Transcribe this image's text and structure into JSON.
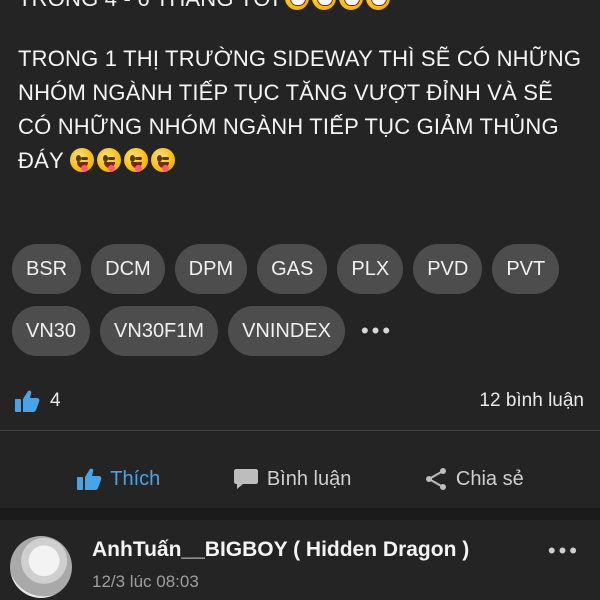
{
  "post": {
    "top_line_text": "TRONG 4 - 6 THÁNG TỚI",
    "body_text": "TRONG 1 THỊ TRƯỜNG SIDEWAY THÌ SẼ CÓ NHỮNG NHÓM NGÀNH TIẾP TỤC TĂNG VƯỢT ĐỈNH VÀ SẼ CÓ NHỮNG NHÓM NGÀNH TIẾP TỤC GIẢM THỦNG ĐÁY"
  },
  "tags": {
    "row1": [
      "BSR",
      "DCM",
      "DPM",
      "GAS",
      "PLX",
      "PVD",
      "PVT"
    ],
    "row2": [
      "VN30",
      "VN30F1M",
      "VNINDEX"
    ],
    "more_label": "•••"
  },
  "stats": {
    "like_count": "4",
    "comment_count": "12 bình luận"
  },
  "actions": {
    "like_label": "Thích",
    "comment_label": "Bình luận",
    "share_label": "Chia sẻ"
  },
  "comment": {
    "author": "AnhTuấn__BIGBOY ( Hidden Dragon )",
    "time": "12/3 lúc 08:03",
    "more_label": "•••"
  },
  "colors": {
    "background": "#242424",
    "tag_bg": "#4d4d4d",
    "accent_like": "#4aa3e8"
  }
}
